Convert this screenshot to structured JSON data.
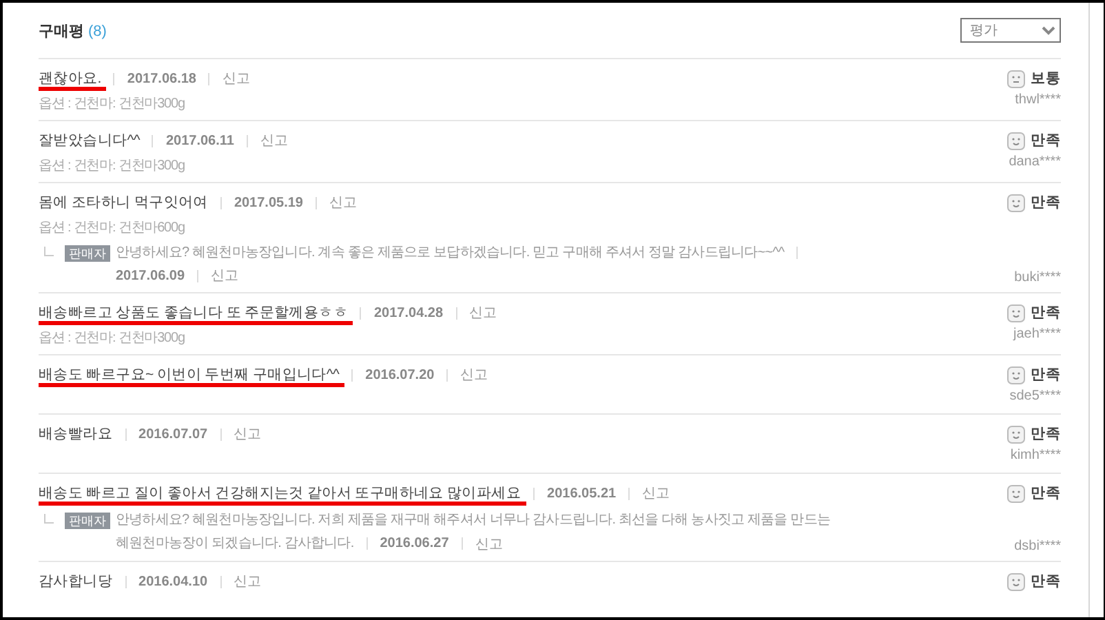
{
  "header": {
    "title": "구매평",
    "count": "(8)"
  },
  "sort_select": {
    "value": "평가"
  },
  "reviews": [
    {
      "text": "괜찮아요.",
      "date": "2017.06.18",
      "report": "신고",
      "option": "옵션 : 건천마: 건천마300g",
      "rating": "보통",
      "kind": "neutral",
      "user": "thwl****",
      "marked": true
    },
    {
      "text": "잘받았습니다^^",
      "date": "2017.06.11",
      "report": "신고",
      "option": "옵션 : 건천마: 건천마300g",
      "rating": "만족",
      "kind": "happy",
      "user": "dana****",
      "marked": false
    },
    {
      "text": "몸에 조타하니 먹구잇어여",
      "date": "2017.05.19",
      "report": "신고",
      "option": "옵션 : 건천마: 건천마600g",
      "rating": "만족",
      "kind": "happy",
      "user": "buki****",
      "marked": false,
      "reply": {
        "badge": "판매자",
        "lines": [
          "안녕하세요? 혜원천마농장입니다. 계속 좋은 제품으로 보답하겠습니다. 믿고 구매해 주셔서 정말 감사드립니다~~^^"
        ],
        "date": "2017.06.09",
        "report": "신고"
      }
    },
    {
      "text": "배송빠르고 상품도 좋습니다 또 주문할께용ㅎㅎ",
      "date": "2017.04.28",
      "report": "신고",
      "option": "옵션 : 건천마: 건천마300g",
      "rating": "만족",
      "kind": "happy",
      "user": "jaeh****",
      "marked": true
    },
    {
      "text": "배송도 빠르구요~ 이번이 두번째 구매입니다^^",
      "date": "2016.07.20",
      "report": "신고",
      "rating": "만족",
      "kind": "happy",
      "user": "sde5****",
      "marked": true
    },
    {
      "text": "배송빨라요",
      "date": "2016.07.07",
      "report": "신고",
      "rating": "만족",
      "kind": "happy",
      "user": "kimh****",
      "marked": false
    },
    {
      "text": "배송도 빠르고 질이 좋아서 건강해지는것 같아서 또구매하네요 많이파세요",
      "date": "2016.05.21",
      "report": "신고",
      "rating": "만족",
      "kind": "happy",
      "user": "dsbi****",
      "marked": true,
      "reply": {
        "badge": "판매자",
        "lines": [
          "안녕하세요? 혜원천마농장입니다. 저희 제품을 재구매 해주셔서 너무나 감사드립니다. 최선을 다해 농사짓고 제품을 만드는",
          "혜원천마농장이 되겠습니다. 감사합니다."
        ],
        "date": "2016.06.27",
        "report": "신고"
      }
    },
    {
      "text": "감사합니당",
      "date": "2016.04.10",
      "report": "신고",
      "rating": "만족",
      "kind": "happy",
      "marked": false
    }
  ]
}
